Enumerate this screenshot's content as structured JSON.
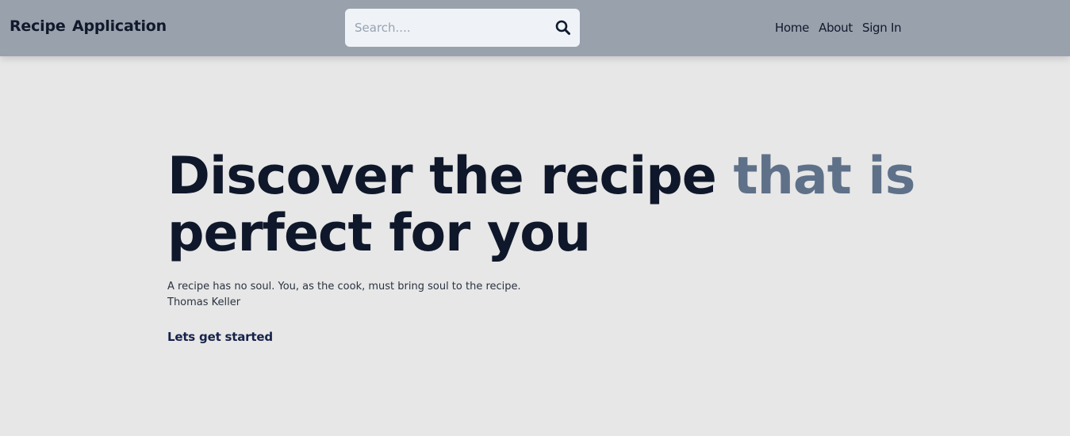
{
  "navbar": {
    "brand": "Recipe Application",
    "search": {
      "placeholder": "Search....",
      "value": "",
      "icon": "search-icon"
    },
    "links": [
      {
        "label": "Home"
      },
      {
        "label": "About"
      },
      {
        "label": "Sign In"
      }
    ]
  },
  "hero": {
    "title_main": "Discover the recipe ",
    "title_accent": "that is",
    "title_rest": " perfect for you",
    "quote": "A recipe has no soul. You, as the cook, must bring soul to the recipe.",
    "quote_author": "Thomas Keller",
    "cta_label": "Lets get started"
  },
  "colors": {
    "navbar_bg": "#99a1ad",
    "page_bg": "#e7e7e7",
    "title": "#0f172a",
    "accent": "#5f7189"
  }
}
